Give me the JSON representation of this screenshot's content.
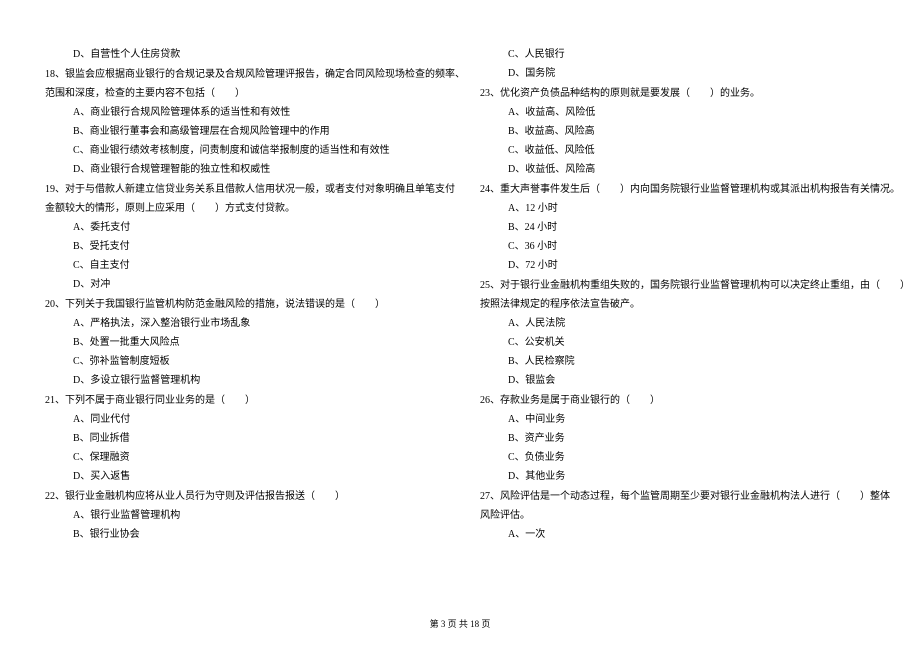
{
  "left": {
    "l0": "D、自营性个人住房贷款",
    "q18": "18、银监会应根据商业银行的合规记录及合规风险管理评报告，确定合同风险现场检查的频率、",
    "q18b": "范围和深度，检查的主要内容不包括（　　）",
    "q18_a": "A、商业银行合规风险管理体系的适当性和有效性",
    "q18_b": "B、商业银行董事会和高级管理层在合规风险管理中的作用",
    "q18_c": "C、商业银行绩效考核制度，问责制度和诚信举报制度的适当性和有效性",
    "q18_d": "D、商业银行合规管理智能的独立性和权威性",
    "q19": "19、对于与借款人新建立信贷业务关系且借款人信用状况一般，或者支付对象明确且单笔支付",
    "q19b": "金额较大的情形，原则上应采用（　　）方式支付贷款。",
    "q19_a": "A、委托支付",
    "q19_b": "B、受托支付",
    "q19_c": "C、自主支付",
    "q19_d": "D、对冲",
    "q20": "20、下列关于我国银行监管机构防范金融风险的措施，说法错误的是（　　）",
    "q20_a": "A、严格执法，深入整治银行业市场乱象",
    "q20_b": "B、处置一批重大风险点",
    "q20_c": "C、弥补监管制度短板",
    "q20_d": "D、多设立银行监督管理机构",
    "q21": "21、下列不属于商业银行同业业务的是（　　）",
    "q21_a": "A、同业代付",
    "q21_b": "B、同业拆借",
    "q21_c": "C、保理融资",
    "q21_d": "D、买入返售",
    "q22": "22、银行业金融机构应将从业人员行为守则及评估报告报送（　　）",
    "q22_a": "A、银行业监督管理机构",
    "q22_b": "B、银行业协会"
  },
  "right": {
    "r0a": "C、人民银行",
    "r0b": "D、国务院",
    "q23": "23、优化资产负债品种结构的原则就是要发展（　　）的业务。",
    "q23_a": "A、收益高、风险低",
    "q23_b": "B、收益高、风险高",
    "q23_c": "C、收益低、风险低",
    "q23_d": "D、收益低、风险高",
    "q24": "24、重大声誉事件发生后（　　）内向国务院银行业监督管理机构或其派出机构报告有关情况。",
    "q24_a": "A、12 小时",
    "q24_b": "B、24 小时",
    "q24_c": "C、36 小时",
    "q24_d": "D、72 小时",
    "q25": "25、对于银行业金融机构重组失败的，国务院银行业监督管理机构可以决定终止重组，由（　　）",
    "q25b": "按照法律规定的程序依法宣告破产。",
    "q25_a": "A、人民法院",
    "q25_b": "C、公安机关",
    "q25_c": "B、人民检察院",
    "q25_d": "D、银监会",
    "q26": "26、存款业务是属于商业银行的（　　）",
    "q26_a": "A、中间业务",
    "q26_b": "B、资产业务",
    "q26_c": "C、负债业务",
    "q26_d": "D、其他业务",
    "q27": "27、风险评估是一个动态过程，每个监管周期至少要对银行业金融机构法人进行（　　）整体",
    "q27b": "风险评估。",
    "q27_a": "A、一次"
  },
  "footer": "第 3 页 共 18 页"
}
